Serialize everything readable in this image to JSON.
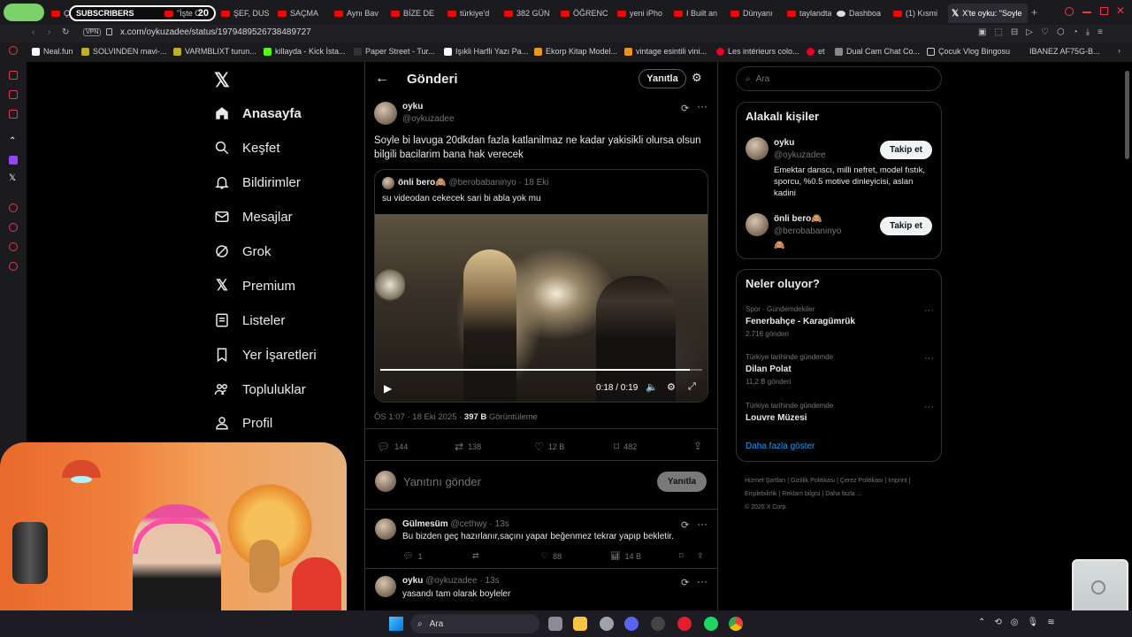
{
  "browser": {
    "tabs": [
      {
        "label": "ÇIN'DEN"
      },
      {
        "label": "SUBSCRIBERS"
      },
      {
        "label": "20"
      },
      {
        "label": "\"İşte O"
      },
      {
        "label": "ŞEF, DUS"
      },
      {
        "label": "SAÇMA"
      },
      {
        "label": "Aynı Bav"
      },
      {
        "label": "BİZE DE"
      },
      {
        "label": "türkiye'd"
      },
      {
        "label": "382 GÜN"
      },
      {
        "label": "ÖĞRENC"
      },
      {
        "label": "yeni iPho"
      },
      {
        "label": "I Built an"
      },
      {
        "label": "Dünyanı"
      },
      {
        "label": "taylandta"
      },
      {
        "label": "Dashboa"
      },
      {
        "label": "(1) Kısmi"
      },
      {
        "label": "X'te oyku: \"Soyle"
      }
    ],
    "url": "x.com/oykuzadee/status/1979489526738489727",
    "vpn": "VPN",
    "bookmarks": [
      "Neal.fun",
      "SOLVINDEN mavi-...",
      "VARMBLIXT turun...",
      "killayda - Kick İsta...",
      "Paper Street - Tur...",
      "Işıkli Harfli Yazı Pa...",
      "Ekorp Kitap Model...",
      "vintage esintili vini...",
      "Les intérieurs colo...",
      "et",
      "Dual Cam Chat Co...",
      "Çocuk Vlog Bingosu",
      "IBANEZ AF75G-B..."
    ]
  },
  "nav": {
    "items": [
      "Anasayfa",
      "Keşfet",
      "Bildirimler",
      "Mesajlar",
      "Grok",
      "Premium",
      "Listeler",
      "Yer İşaretleri",
      "Topluluklar",
      "Profil"
    ]
  },
  "post": {
    "header": "Gönderi",
    "reply_btn": "Yanıtla",
    "author_name": "oyku",
    "author_handle": "@oykuzadee",
    "text": "Soyle bi lavuga 20dkdan fazla katlanilmaz ne kadar yakisikli olursa olsun bilgili bacilarim bana hak verecek",
    "quote_name": "önli bero🙈",
    "quote_handle": "@berobabaninyo · 18 Eki",
    "quote_text": "su videodan cekecek sari bi abla yok mu",
    "video_time": "0:18 / 0:19",
    "time": "ÖS 1:07 · 18 Eki 2025 ·",
    "views": "397 B",
    "views_label": "Görüntüleme",
    "replies": "144",
    "reposts": "138",
    "likes": "12 B",
    "bookmarks": "482",
    "compose_placeholder": "Yanıtını gönder",
    "compose_btn": "Yanıtla"
  },
  "replies": [
    {
      "name": "Gülmesüm",
      "handle": "@cethwy · 13s",
      "text": "Bu bizden geç hazırlanır,saçını yapar beğenmez tekrar yapıp bekletir.",
      "replies": "1",
      "likes": "88",
      "views": "14 B"
    },
    {
      "name": "oyku",
      "handle": "@oykuzadee · 13s",
      "text": "yasandı tam olarak boyleler"
    }
  ],
  "right": {
    "search_placeholder": "Ara",
    "related_title": "Alakalı kişiler",
    "people": [
      {
        "name": "oyku",
        "handle": "@oykuzadee",
        "bio": "Emektar danscı, milli nefret, model fıstık, sporcu, %0.5 motive dinleyicisi, aslan kadini",
        "follow": "Takip et"
      },
      {
        "name": "önli bero🙈",
        "handle": "@berobabaninyo",
        "bio": "🙈",
        "follow": "Takip et"
      }
    ],
    "trends_title": "Neler oluyor?",
    "trends": [
      {
        "context": "Spor · Gündemdekiler",
        "name": "Fenerbahçe - Karagümrük",
        "count": "2.716 gönderi"
      },
      {
        "context": "Türkiye tarihinde gündemde",
        "name": "Dilan Polat",
        "count": "11,2 B gönderi"
      },
      {
        "context": "Türkiye tarihinde gündemde",
        "name": "Louvre Müzesi",
        "count": ""
      }
    ],
    "show_more": "Daha fazla göster",
    "footer": [
      "Hizmet Şartları",
      "Gizlilik Politikası",
      "Çerez Politikası",
      "Imprint",
      "Erişilebilirlik",
      "Reklam bilgisi",
      "Daha fazla ...",
      "© 2025 X Corp."
    ]
  },
  "taskbar": {
    "search": "Ara"
  }
}
